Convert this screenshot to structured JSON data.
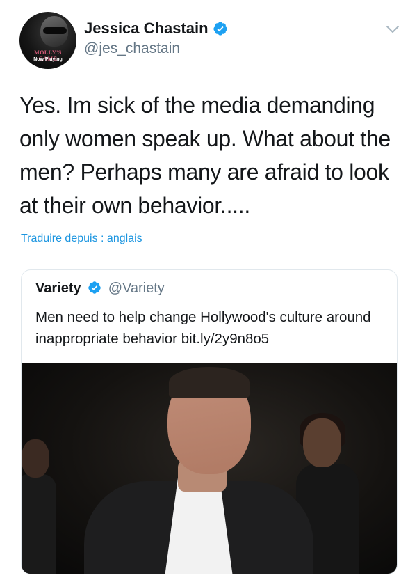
{
  "user": {
    "name": "Jessica Chastain",
    "handle": "@jes_chastain",
    "avatar": {
      "poster_title": "MOLLY'S GAME",
      "poster_caption": "Now Playing"
    },
    "verified": true
  },
  "tweet": {
    "text": "Yes. Im sick of the media demanding only women speak up. What about the men? Perhaps many are afraid to look at their own behavior.....",
    "translate_link": "Traduire depuis : anglais"
  },
  "quoted_tweet": {
    "name": "Variety",
    "handle": "@Variety",
    "verified": true,
    "text": "Men need to help change Hollywood's culture around inappropriate behavior bit.ly/2y9n8o5"
  },
  "colors": {
    "link": "#1b95e0",
    "verified_badge": "#1da1f2",
    "secondary_text": "#657786",
    "border": "#e1e8ed"
  },
  "icons": [
    "verified-badge-icon",
    "chevron-down-icon"
  ]
}
